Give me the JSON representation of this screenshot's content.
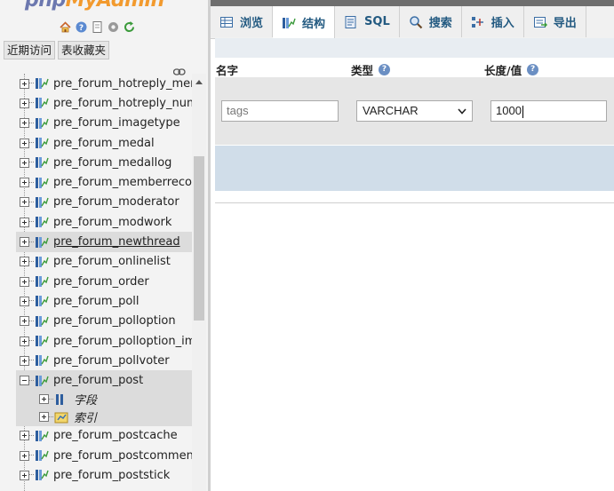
{
  "logo": {
    "php": "php",
    "admin": "MyAdmin"
  },
  "quick_icons": [
    "home-icon",
    "help-icon",
    "docs-icon",
    "settings-icon",
    "reload-icon"
  ],
  "nav_buttons": {
    "recent": "近期访问",
    "favorites": "表收藏夹"
  },
  "tree": {
    "tables": [
      {
        "name": "pre_forum_hotreply_mer",
        "state": "collapsed"
      },
      {
        "name": "pre_forum_hotreply_num",
        "state": "collapsed"
      },
      {
        "name": "pre_forum_imagetype",
        "state": "collapsed"
      },
      {
        "name": "pre_forum_medal",
        "state": "collapsed"
      },
      {
        "name": "pre_forum_medallog",
        "state": "collapsed"
      },
      {
        "name": "pre_forum_memberrecor",
        "state": "collapsed"
      },
      {
        "name": "pre_forum_moderator",
        "state": "collapsed"
      },
      {
        "name": "pre_forum_modwork",
        "state": "collapsed"
      },
      {
        "name": "pre_forum_newthread",
        "state": "collapsed",
        "highlight": true
      },
      {
        "name": "pre_forum_onlinelist",
        "state": "collapsed"
      },
      {
        "name": "pre_forum_order",
        "state": "collapsed"
      },
      {
        "name": "pre_forum_poll",
        "state": "collapsed"
      },
      {
        "name": "pre_forum_polloption",
        "state": "collapsed"
      },
      {
        "name": "pre_forum_polloption_im",
        "state": "collapsed"
      },
      {
        "name": "pre_forum_pollvoter",
        "state": "collapsed"
      },
      {
        "name": "pre_forum_post",
        "state": "expanded"
      },
      {
        "name": "pre_forum_postcache",
        "state": "collapsed"
      },
      {
        "name": "pre_forum_postcommen",
        "state": "collapsed"
      },
      {
        "name": "pre_forum_poststick",
        "state": "collapsed"
      }
    ],
    "post_children": {
      "columns": "字段",
      "indexes": "索引"
    }
  },
  "tabs": [
    {
      "label": "浏览",
      "icon": "browse-icon"
    },
    {
      "label": "结构",
      "icon": "structure-icon",
      "active": true
    },
    {
      "label": "SQL",
      "icon": "sql-icon"
    },
    {
      "label": "搜索",
      "icon": "search-icon"
    },
    {
      "label": "插入",
      "icon": "insert-icon"
    },
    {
      "label": "导出",
      "icon": "export-icon"
    }
  ],
  "form": {
    "headers": {
      "name": "名字",
      "type": "类型",
      "length": "长度/值"
    },
    "name_value": "tags",
    "type_value": "VARCHAR",
    "length_value": "1000"
  }
}
